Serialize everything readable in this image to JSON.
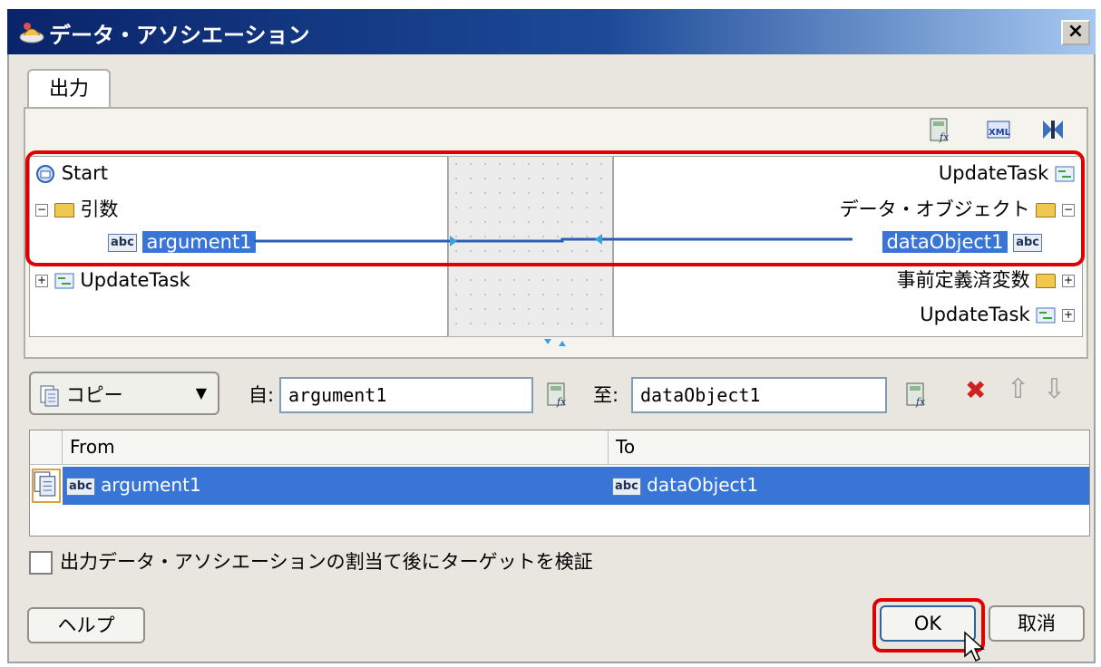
{
  "window": {
    "title": "データ・アソシエーション",
    "close_label": "×"
  },
  "tab": {
    "label": "出力"
  },
  "toolbar": {
    "icons": [
      "expression-builder-icon",
      "xml-fragment-icon",
      "auto-map-icon"
    ]
  },
  "source_tree": {
    "items": [
      {
        "label": "Start",
        "icon": "start-event-icon"
      },
      {
        "label": "引数",
        "icon": "folder-icon"
      },
      {
        "label": "argument1",
        "icon": "string-variable-icon",
        "selected": true
      },
      {
        "label": "UpdateTask",
        "icon": "task-icon"
      }
    ]
  },
  "target_tree": {
    "items": [
      {
        "label": "UpdateTask",
        "icon": "task-icon"
      },
      {
        "label": "データ・オブジェクト",
        "icon": "folder-icon"
      },
      {
        "label": "dataObject1",
        "icon": "string-variable-icon",
        "selected": true
      },
      {
        "label": "事前定義済変数",
        "icon": "folder-icon"
      },
      {
        "label": "UpdateTask",
        "icon": "task-icon"
      }
    ]
  },
  "mapping": {
    "operation": "コピー",
    "from_label": "自:",
    "from_value": "argument1",
    "to_label": "至:",
    "to_value": "dataObject1"
  },
  "grid": {
    "columns": [
      "From",
      "To"
    ],
    "rows": [
      {
        "from": "argument1",
        "to": "dataObject1"
      }
    ]
  },
  "validate_checkbox": {
    "label": "出力データ・アソシエーションの割当て後にターゲットを検証",
    "checked": false
  },
  "buttons": {
    "help": "ヘルプ",
    "ok": "OK",
    "cancel": "取消"
  },
  "icon_glyphs": {
    "abc": "abc",
    "delete": "✖",
    "up": "⇧",
    "down": "⇩"
  }
}
